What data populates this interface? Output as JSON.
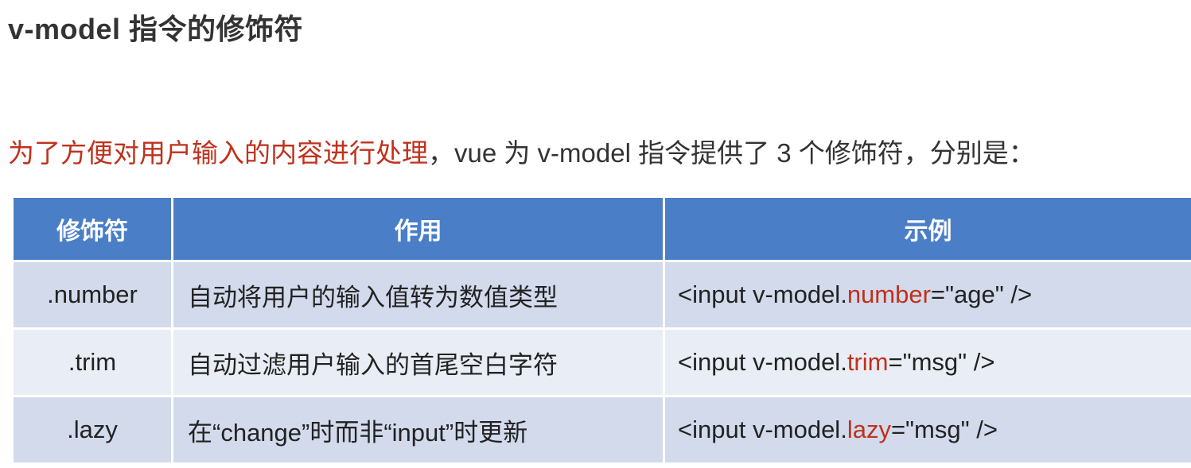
{
  "title": "v-model 指令的修饰符",
  "intro": {
    "highlight": "为了方便对用户输入的内容进行处理",
    "rest": "，vue 为 v-model 指令提供了 3 个修饰符，分别是："
  },
  "table": {
    "headers": [
      "修饰符",
      "作用",
      "示例"
    ],
    "rows": [
      {
        "modifier": ".number",
        "effect": "自动将用户的输入值转为数值类型",
        "example": {
          "prefix": "<input  v-model.",
          "modifier": "number",
          "suffix": "=\"age\" />"
        }
      },
      {
        "modifier": ".trim",
        "effect": "自动过滤用户输入的首尾空白字符",
        "example": {
          "prefix": "<input  v-model.",
          "modifier": "trim",
          "suffix": "=\"msg\" />"
        }
      },
      {
        "modifier": ".lazy",
        "effect": "在“change”时而非“input”时更新",
        "example": {
          "prefix": "<input  v-model.",
          "modifier": "lazy",
          "suffix": "=\"msg\" />"
        }
      }
    ]
  },
  "colors": {
    "accent_red": "#c0311c",
    "header_blue": "#4a7ec7",
    "row_dark": "#d2daec",
    "row_light": "#e9edf5"
  }
}
